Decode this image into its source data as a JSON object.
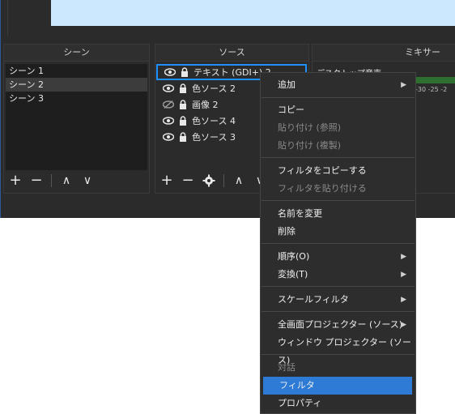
{
  "colors": {
    "accent": "#1e90ff",
    "menu_highlight": "#2d7bd5",
    "panel": "#2b2b2b",
    "list": "#1e1e1e"
  },
  "scenes": {
    "title": "シーン",
    "items": [
      {
        "label": "シーン 1"
      },
      {
        "label": "シーン 2"
      },
      {
        "label": "シーン 3"
      }
    ]
  },
  "sources": {
    "title": "ソース",
    "items": [
      {
        "label": "テキスト (GDI+) 2",
        "visibility": "eye-icon"
      },
      {
        "label": "色ソース 2",
        "visibility": "eye-icon"
      },
      {
        "label": "画像 2",
        "visibility": "eye-hidden-icon"
      },
      {
        "label": "色ソース 4",
        "visibility": "eye-icon"
      },
      {
        "label": "色ソース 3",
        "visibility": "eye-icon"
      }
    ]
  },
  "mixer": {
    "title": "ミキサー",
    "track_label": "デスクトップ音声",
    "scale": "-30   -25   -2"
  },
  "toolbar": {
    "add": "+",
    "remove": "−",
    "up": "∧",
    "down": "∨",
    "settings_icon": "gear-icon"
  },
  "context_menu": {
    "items": [
      {
        "label": "追加",
        "submenu": true
      },
      {
        "label": "コピー"
      },
      {
        "label": "貼り付け (参照)",
        "disabled": true
      },
      {
        "label": "貼り付け (複製)",
        "disabled": true
      },
      {
        "label": "フィルタをコピーする"
      },
      {
        "label": "フィルタを貼り付ける",
        "disabled": true
      },
      {
        "label": "名前を変更"
      },
      {
        "label": "削除"
      },
      {
        "label": "順序(O)",
        "submenu": true
      },
      {
        "label": "変換(T)",
        "submenu": true
      },
      {
        "label": "スケールフィルタ",
        "submenu": true
      },
      {
        "label": "全画面プロジェクター (ソース)",
        "submenu": true
      },
      {
        "label": "ウィンドウ プロジェクター (ソース)"
      },
      {
        "label": "対話",
        "disabled": true
      },
      {
        "label": "フィルタ",
        "active": true
      },
      {
        "label": "プロパティ"
      }
    ]
  }
}
